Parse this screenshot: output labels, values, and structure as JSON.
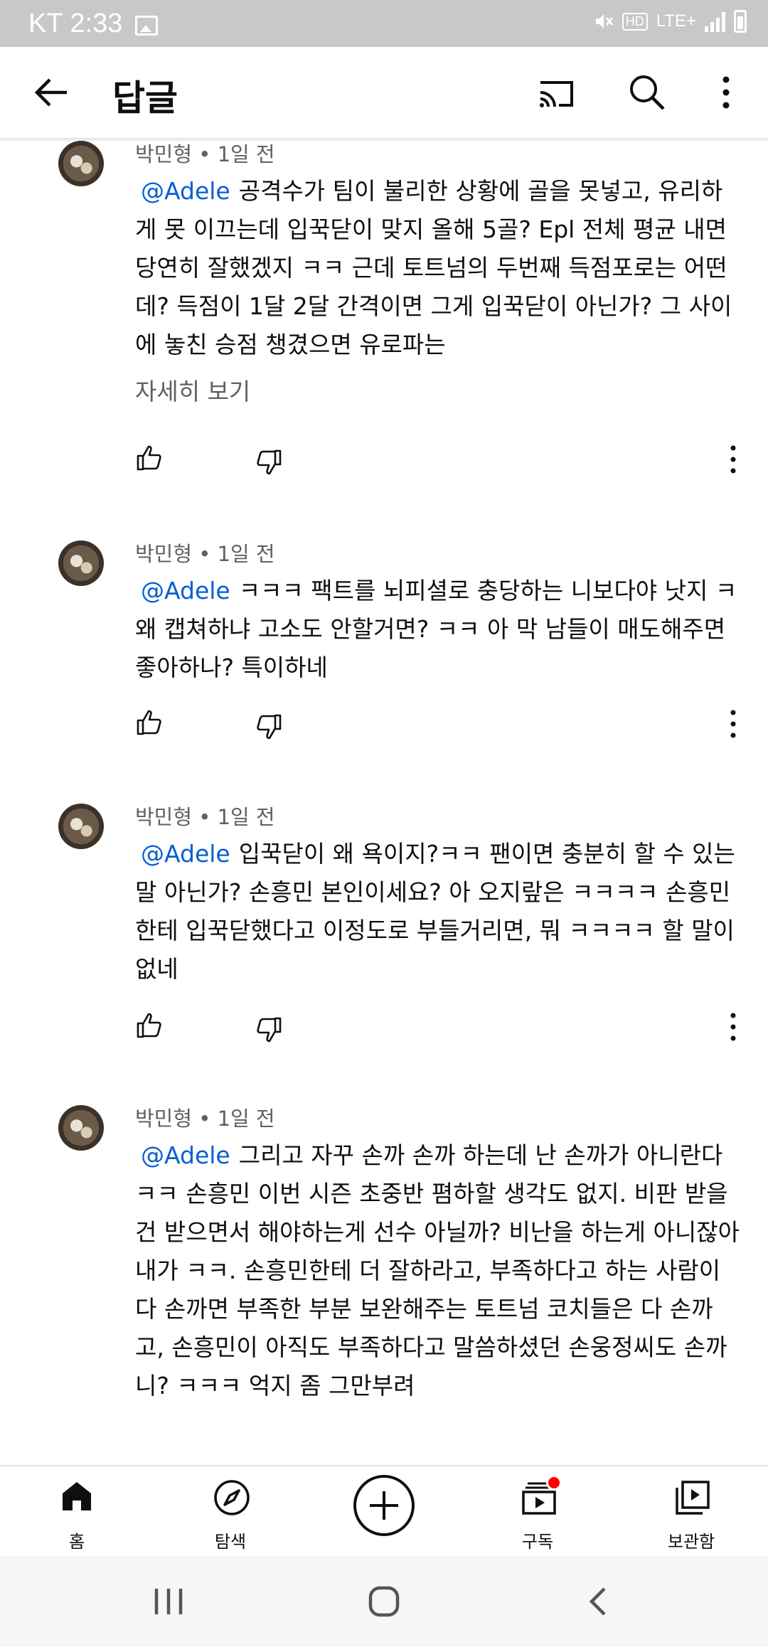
{
  "status_bar": {
    "carrier_time": "KT 2:33",
    "hd_badge": "HD",
    "network": "LTE+"
  },
  "app_bar": {
    "title": "답글"
  },
  "comments": [
    {
      "author_meta": "박민형 • 1일 전",
      "mention": "@Adele",
      "text": "공격수가 팀이 불리한 상황에 골을 못넣고, 유리하게 못 이끄는데 입꾹닫이 맞지 올해 5골? Epl  전체 평균 내면 당연히 잘했겠지 ㅋㅋ 근데 토트넘의 두번째 득점포로는 어떤데? 득점이 1달 2달 간격이면 그게 입꾹닫이 아닌가? 그 사이에 놓친 승점 챙겼으면 유로파는",
      "read_more": "자세히 보기"
    },
    {
      "author_meta": "박민형 • 1일 전",
      "mention": "@Adele",
      "text": "ㅋㅋㅋ 팩트를 뇌피셜로 충당하는 니보다야 낫지 ㅋ 왜 캡쳐하냐 고소도 안할거면? ㅋㅋ 아 막 남들이 매도해주면 좋아하나? 특이하네"
    },
    {
      "author_meta": "박민형 • 1일 전",
      "mention": "@Adele",
      "text": "입꾹닫이 왜 욕이지?ㅋㅋ 팬이면 충분히 할 수 있는 말 아닌가? 손흥민 본인이세요? 아 오지랖은 ㅋㅋㅋㅋ 손흥민한테 입꾹닫했다고 이정도로 부들거리면, 뭐 ㅋㅋㅋㅋ 할 말이 없네"
    },
    {
      "author_meta": "박민형 • 1일 전",
      "mention": "@Adele",
      "text": "그리고 자꾸 손까 손까 하는데 난 손까가 아니란다 ㅋㅋ 손흥민 이번 시즌 초중반 폄하할 생각도 없지. 비판 받을건 받으면서 해야하는게 선수 아닐까? 비난을 하는게 아니잖아  내가 ㅋㅋ. 손흥민한테 더 잘하라고, 부족하다고 하는 사람이 다 손까면 부족한 부분 보완해주는 토트넘 코치들은 다 손까고, 손흥민이 아직도 부족하다고 말씀하셨던 손웅정씨도 손까니? ㅋㅋㅋ 억지 좀 그만부려"
    }
  ],
  "bottom_nav": [
    {
      "label": "홈"
    },
    {
      "label": "탐색"
    },
    {
      "label": "구독"
    },
    {
      "label": "보관함"
    }
  ],
  "colors": {
    "mention": "#065fd4",
    "meta": "#606060",
    "status_bar": "#c8c8c8",
    "notification_dot": "#ff0000"
  }
}
